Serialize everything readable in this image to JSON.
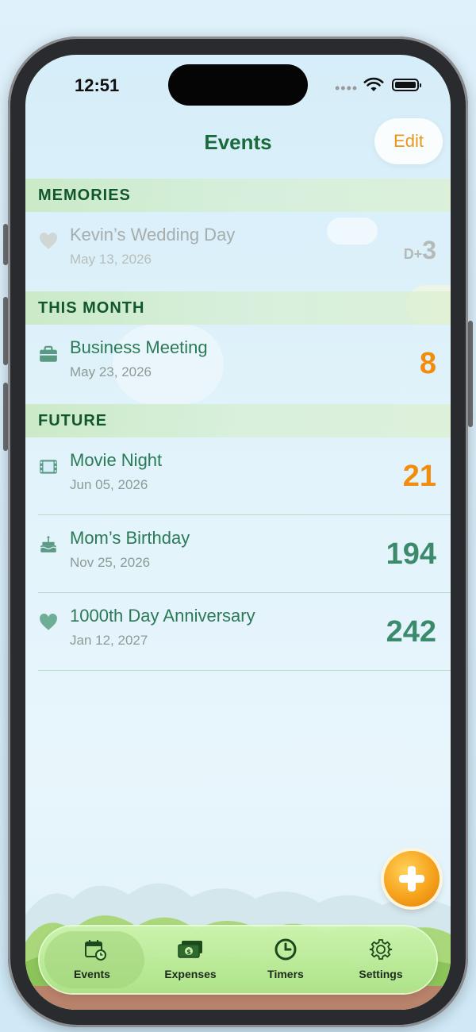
{
  "status_bar": {
    "time": "12:51"
  },
  "header": {
    "title": "Events",
    "edit_label": "Edit"
  },
  "sections": [
    {
      "title": "MEMORIES",
      "events": [
        {
          "icon": "heart-icon",
          "title": "Kevin’s Wedding Day",
          "date": "May 13, 2026",
          "count_prefix": "D+",
          "count": "3",
          "state": "past"
        }
      ]
    },
    {
      "title": "THIS MONTH",
      "events": [
        {
          "icon": "briefcase-icon",
          "title": "Business Meeting",
          "date": "May 23, 2026",
          "count": "8",
          "state": "soon"
        }
      ]
    },
    {
      "title": "FUTURE",
      "events": [
        {
          "icon": "film-icon",
          "title": "Movie Night",
          "date": "Jun 05, 2026",
          "count": "21",
          "state": "soon"
        },
        {
          "icon": "birthday-cake-icon",
          "title": "Mom’s Birthday",
          "date": "Nov 25, 2026",
          "count": "194",
          "state": "future"
        },
        {
          "icon": "heart-icon",
          "title": "1000th Day Anniversary",
          "date": "Jan 12, 2027",
          "count": "242",
          "state": "future"
        }
      ]
    }
  ],
  "tabs": [
    {
      "label": "Events",
      "icon": "calendar-clock-icon",
      "active": true
    },
    {
      "label": "Expenses",
      "icon": "money-icon",
      "active": false
    },
    {
      "label": "Timers",
      "icon": "clock-icon",
      "active": false
    },
    {
      "label": "Settings",
      "icon": "gear-icon",
      "active": false
    }
  ],
  "colors": {
    "accent_orange": "#f28c0a",
    "primary_green": "#1a6b3c",
    "tabbar_green": "#b0e68c"
  }
}
